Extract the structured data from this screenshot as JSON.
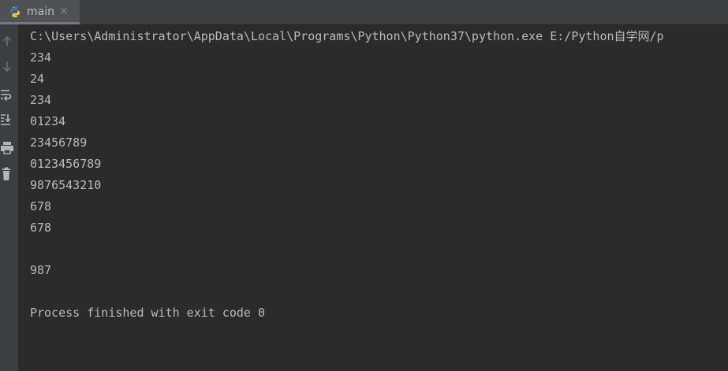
{
  "tab": {
    "label": "main",
    "icon": "python-icon",
    "close_glyph": "✕"
  },
  "toolbar": {
    "items": [
      {
        "name": "up-arrow-icon"
      },
      {
        "name": "down-arrow-icon"
      },
      {
        "name": "soft-wrap-icon"
      },
      {
        "name": "scroll-to-end-icon"
      },
      {
        "name": "print-icon"
      },
      {
        "name": "trash-icon"
      }
    ]
  },
  "console": {
    "lines": [
      "C:\\Users\\Administrator\\AppData\\Local\\Programs\\Python\\Python37\\python.exe E:/Python自学网/p",
      "234",
      "24",
      "234",
      "01234",
      "23456789",
      "0123456789",
      "9876543210",
      "678",
      "678",
      "",
      "987",
      "",
      "Process finished with exit code 0"
    ]
  },
  "colors": {
    "background": "#2b2b2b",
    "panel": "#3c3f41",
    "text": "#bbbbbb",
    "python_blue": "#3c78aa",
    "python_yellow": "#f5c342"
  }
}
